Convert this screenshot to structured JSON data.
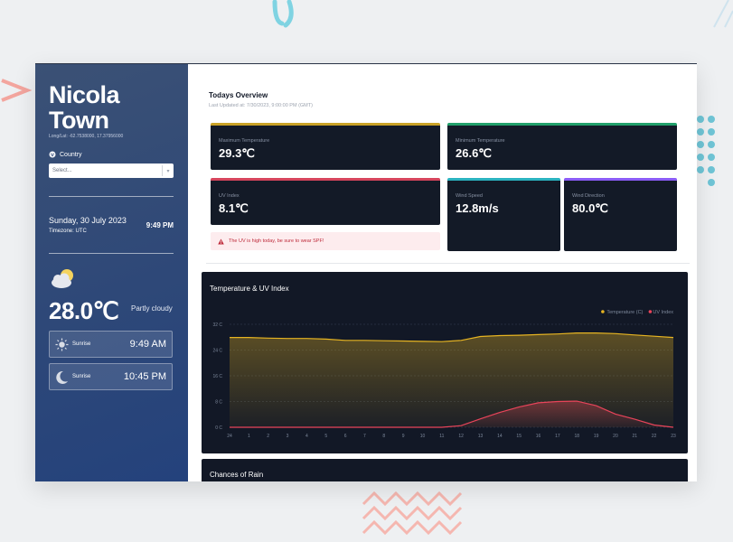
{
  "sidebar": {
    "city": "Nicola Town",
    "coords": "Long/Lat: -62.7538000, 17.37956000",
    "country_label": "Country",
    "country_placeholder": "Select...",
    "date": "Sunday, 30 July 2023",
    "timezone": "Timezone: UTC",
    "time": "9:49 PM",
    "weather_icon": "partly-cloudy-icon",
    "temperature": "28.0℃",
    "condition": "Partly cloudy",
    "sun_times": [
      {
        "label": "Sunrise",
        "value": "9:49 AM",
        "icon": "sun-icon"
      },
      {
        "label": "Sunrise",
        "value": "10:45 PM",
        "icon": "moon-icon"
      }
    ]
  },
  "overview": {
    "title": "Todays Overview",
    "updated": "Last Updated at: 7/30/2023, 9:00:00 PM (GMT)",
    "cards": [
      {
        "title": "Maximum Temperature",
        "value": "29.3℃",
        "color": "#c9a227"
      },
      {
        "title": "Minimum Temperature",
        "value": "26.6℃",
        "color": "#22a06b"
      },
      {
        "title": "UV Index",
        "value": "8.1℃",
        "color": "#d6455d"
      },
      {
        "title": "Wind Speed",
        "value": "12.8m/s",
        "color": "#2bb3c0"
      },
      {
        "title": "Wind Direction",
        "value": "80.0℃",
        "color": "#8b5cf6"
      }
    ],
    "uv_alert": "The UV is high today, be sure to wear SPF!"
  },
  "rain": {
    "title": "Chances of Rain"
  },
  "chart_data": {
    "type": "line",
    "title": "Temperature & UV Index",
    "categories": [
      "24",
      "1",
      "2",
      "3",
      "4",
      "5",
      "6",
      "7",
      "8",
      "9",
      "10",
      "11",
      "12",
      "13",
      "14",
      "15",
      "16",
      "17",
      "18",
      "19",
      "20",
      "21",
      "22",
      "23"
    ],
    "yticks": [
      "0 C",
      "8 C",
      "16 C",
      "24 C",
      "32 C"
    ],
    "ylim": [
      0,
      32
    ],
    "grid": true,
    "legend_position": "top-right",
    "series": [
      {
        "name": "Temperature (C)",
        "color": "#e6b422",
        "values": [
          27.9,
          27.9,
          27.7,
          27.6,
          27.6,
          27.4,
          27.0,
          27.0,
          26.9,
          26.8,
          26.7,
          26.6,
          27.0,
          28.2,
          28.5,
          28.6,
          28.8,
          29.0,
          29.3,
          29.3,
          29.1,
          28.7,
          28.3,
          27.9
        ]
      },
      {
        "name": "UV Index",
        "color": "#e8445a",
        "values": [
          0,
          0,
          0,
          0,
          0,
          0,
          0,
          0,
          0,
          0,
          0,
          0,
          0.5,
          2.6,
          4.6,
          6.3,
          7.6,
          8.0,
          8.1,
          6.7,
          4.1,
          2.5,
          0.7,
          0
        ]
      }
    ]
  }
}
